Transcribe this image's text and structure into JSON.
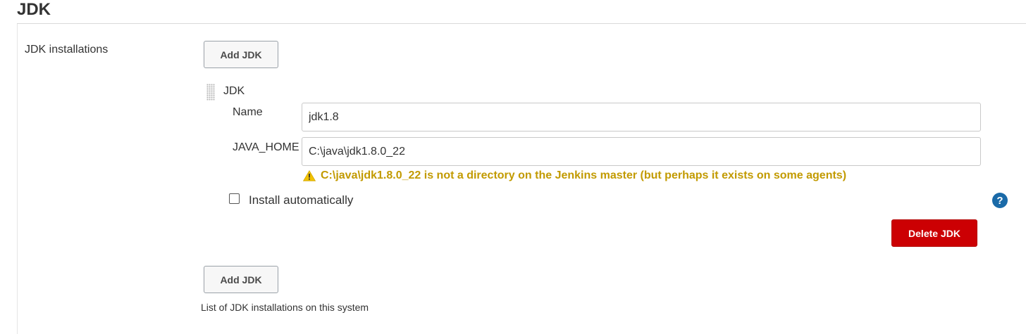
{
  "section": {
    "title": "JDK"
  },
  "jdk_installations": {
    "label": "JDK installations",
    "add_button_label": "Add JDK",
    "description": "List of JDK installations on this system"
  },
  "jdk_entry": {
    "header": "JDK",
    "name_label": "Name",
    "name_value": "jdk1.8",
    "java_home_label": "JAVA_HOME",
    "java_home_value": "C:\\java\\jdk1.8.0_22",
    "warning_text": "C:\\java\\jdk1.8.0_22 is not a directory on the Jenkins master (but perhaps it exists on some agents)",
    "install_auto_label": "Install automatically",
    "install_auto_checked": false,
    "delete_button_label": "Delete JDK",
    "help_icon": "?"
  },
  "icons": {
    "warning": "warning-triangle-icon",
    "help": "help-icon",
    "drag": "drag-handle-icon"
  },
  "colors": {
    "warning": "#c29a00",
    "delete_button": "#cc0003",
    "help_icon": "#1a6aa8"
  }
}
